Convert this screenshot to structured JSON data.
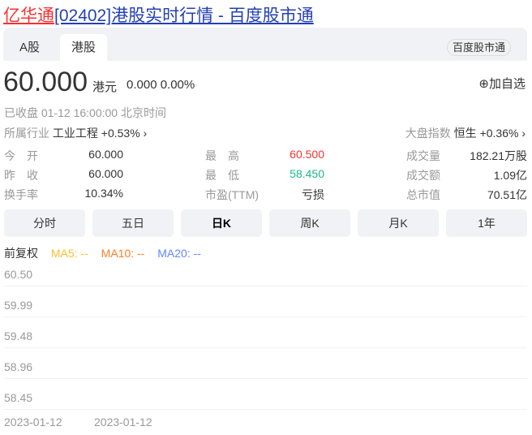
{
  "title": {
    "name": "亿华通",
    "rest": "[02402]港股实时行情 - 百度股市通"
  },
  "tabs": [
    "A股",
    "港股"
  ],
  "brand_button": "百度股市通",
  "quote": {
    "price": "60.000",
    "unit": "港元",
    "change": "0.000 0.00%",
    "add_watch": "加自选",
    "status": "已收盘  01-12 16:00:00  北京时间",
    "industry_label": "所属行业",
    "industry": "工业工程",
    "industry_change": "+0.53%",
    "index_label": "大盘指数",
    "index": "恒生",
    "index_change": "+0.36%"
  },
  "stats": [
    [
      {
        "l": "今　开",
        "v": "60.000"
      },
      {
        "l": "最　高",
        "v": "60.500"
      },
      {
        "l": "成交量",
        "v": "182.21万股"
      }
    ],
    [
      {
        "l": "昨　收",
        "v": "60.000"
      },
      {
        "l": "最　低",
        "v": "58.450"
      },
      {
        "l": "成交额",
        "v": "1.09亿"
      }
    ],
    [
      {
        "l": "换手率",
        "v": "10.34%"
      },
      {
        "l": "市盈(TTM)",
        "v": "亏损"
      },
      {
        "l": "总市值",
        "v": "70.51亿"
      }
    ]
  ],
  "periods": [
    "分时",
    "五日",
    "日K",
    "周K",
    "月K",
    "1年"
  ],
  "ma": {
    "adj": "前复权",
    "ma5": "MA5: --",
    "ma10": "MA10: --",
    "ma20": "MA20: --"
  },
  "colors": {
    "up": "#f73131",
    "down": "#1cb98b",
    "ma5": "#fec02d",
    "ma10": "#ff7f24",
    "ma20": "#5f86ff"
  },
  "chart": {
    "y_ticks": [
      "60.50",
      "59.99",
      "59.48",
      "58.96",
      "58.45"
    ],
    "x_ticks": [
      "2023-01-12",
      "2023-01-12"
    ]
  }
}
